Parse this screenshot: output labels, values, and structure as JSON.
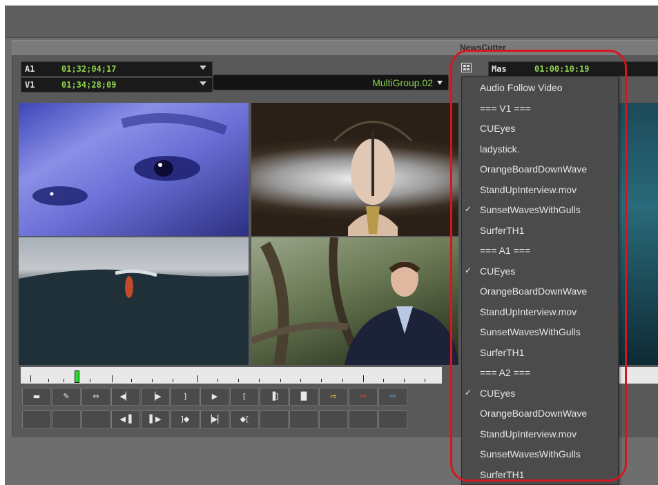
{
  "window": {
    "title": "NewsCutter"
  },
  "timecode": {
    "a1": {
      "track": "A1",
      "value": "01;32;04;17"
    },
    "v1": {
      "track": "V1",
      "value": "01;34;28;09"
    }
  },
  "clip": {
    "name": "MultiGroup.02"
  },
  "master": {
    "label": "Mas",
    "value": "01:00:10:19"
  },
  "menu": {
    "items": [
      {
        "label": "Audio Follow Video",
        "checked": false
      },
      {
        "label": "=== V1 ===",
        "checked": false
      },
      {
        "label": "CUEyes",
        "checked": false
      },
      {
        "label": "ladystick.",
        "checked": false
      },
      {
        "label": "OrangeBoardDownWave",
        "checked": false
      },
      {
        "label": "StandUpInterview.mov",
        "checked": false
      },
      {
        "label": "SunsetWavesWithGulls",
        "checked": true
      },
      {
        "label": "SurferTH1",
        "checked": false
      },
      {
        "label": "=== A1 ===",
        "checked": false
      },
      {
        "label": "CUEyes",
        "checked": true
      },
      {
        "label": "OrangeBoardDownWave",
        "checked": false
      },
      {
        "label": "StandUpInterview.mov",
        "checked": false
      },
      {
        "label": "SunsetWavesWithGulls",
        "checked": false
      },
      {
        "label": "SurferTH1",
        "checked": false
      },
      {
        "label": "=== A2 ===",
        "checked": false
      },
      {
        "label": "CUEyes",
        "checked": true
      },
      {
        "label": "OrangeBoardDownWave",
        "checked": false
      },
      {
        "label": "StandUpInterview.mov",
        "checked": false
      },
      {
        "label": "SunsetWavesWithGulls",
        "checked": false
      },
      {
        "label": "SurferTH1",
        "checked": false
      }
    ],
    "check_glyph": "✓"
  },
  "colors": {
    "timecode_green": "#8fd14f",
    "callout_red": "#d6161e",
    "menu_bg": "#4b4b4b"
  }
}
